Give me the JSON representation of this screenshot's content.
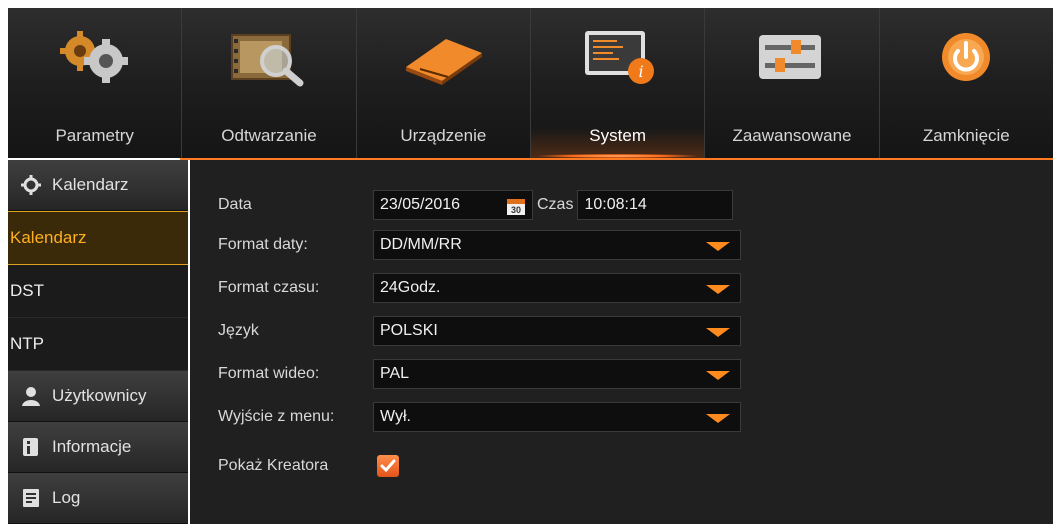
{
  "tabs": [
    {
      "label": "Parametry",
      "icon": "gears-icon"
    },
    {
      "label": "Odtwarzanie",
      "icon": "film-search-icon"
    },
    {
      "label": "Urządzenie",
      "icon": "hard-drive-icon"
    },
    {
      "label": "System",
      "icon": "system-info-icon",
      "active": true
    },
    {
      "label": "Zaawansowane",
      "icon": "sliders-icon"
    },
    {
      "label": "Zamknięcie",
      "icon": "power-icon"
    }
  ],
  "sidebar": {
    "kalendarz_header": "Kalendarz",
    "items": [
      "Kalendarz",
      "DST",
      "NTP"
    ],
    "uzytkownicy": "Użytkownicy",
    "informacje": "Informacje",
    "log": "Log"
  },
  "form": {
    "data_label": "Data",
    "data_value": "23/05/2016",
    "calendar_day": "30",
    "czas_label": "Czas",
    "czas_value": "10:08:14",
    "format_daty_label": "Format daty:",
    "format_daty_value": "DD/MM/RR",
    "format_czasu_label": "Format czasu:",
    "format_czasu_value": "24Godz.",
    "jezyk_label": "Język",
    "jezyk_value": "POLSKI",
    "format_wideo_label": "Format wideo:",
    "format_wideo_value": "PAL",
    "wyjscie_label": "Wyjście z menu:",
    "wyjscie_value": "Wył.",
    "kreator_label": "Pokaż Kreatora",
    "kreator_checked": true
  },
  "colors": {
    "accent": "#ff7a22",
    "active_text": "#ffb020"
  }
}
